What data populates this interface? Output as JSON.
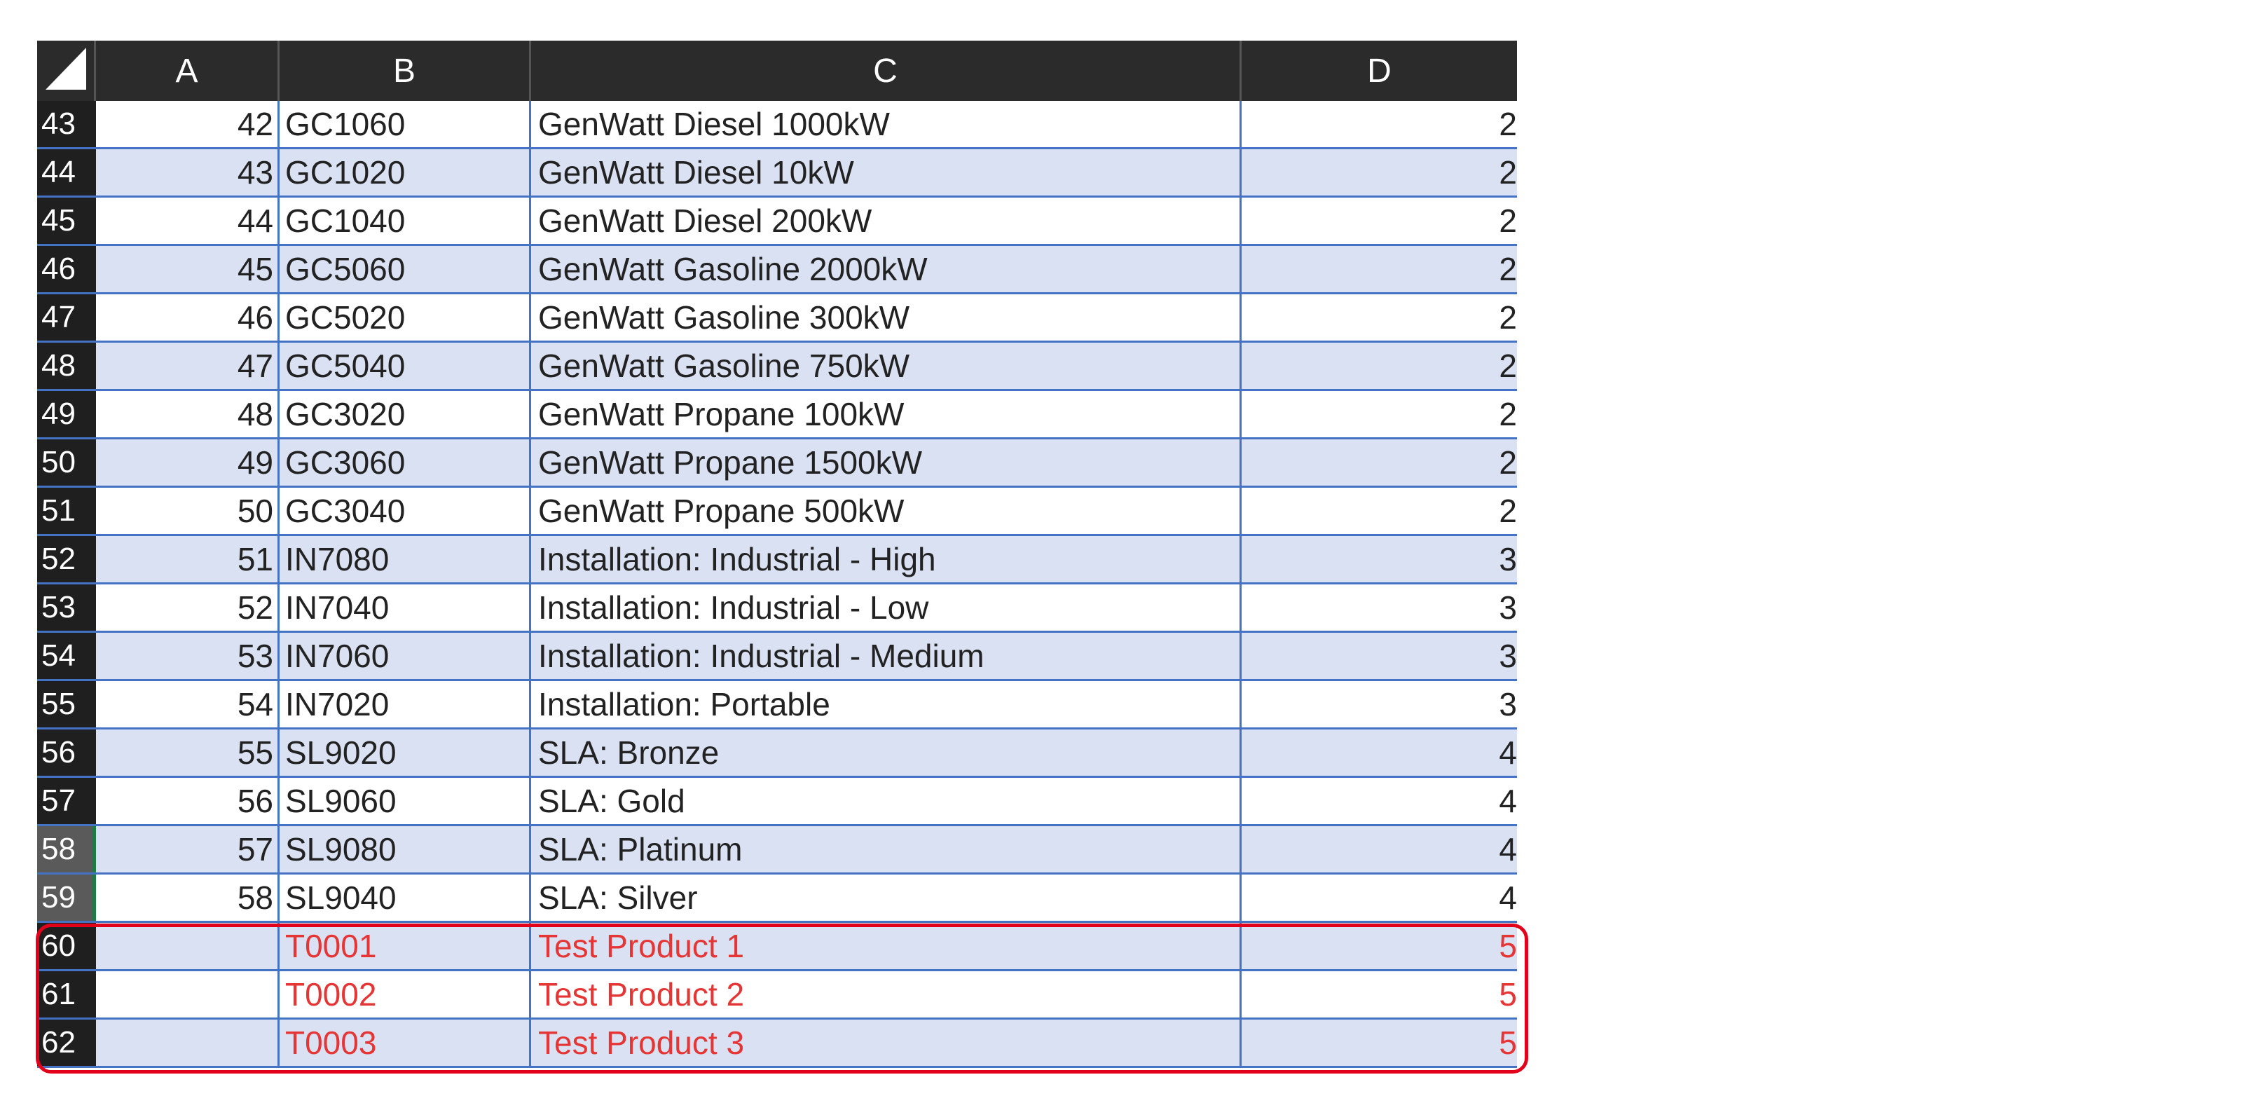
{
  "columns": [
    "A",
    "B",
    "C",
    "D"
  ],
  "rows": [
    {
      "row": "43",
      "a": "42",
      "b": "GC1060",
      "c": "GenWatt Diesel 1000kW",
      "d": "2"
    },
    {
      "row": "44",
      "a": "43",
      "b": "GC1020",
      "c": "GenWatt Diesel 10kW",
      "d": "2"
    },
    {
      "row": "45",
      "a": "44",
      "b": "GC1040",
      "c": "GenWatt Diesel 200kW",
      "d": "2"
    },
    {
      "row": "46",
      "a": "45",
      "b": "GC5060",
      "c": "GenWatt Gasoline 2000kW",
      "d": "2"
    },
    {
      "row": "47",
      "a": "46",
      "b": "GC5020",
      "c": "GenWatt Gasoline 300kW",
      "d": "2"
    },
    {
      "row": "48",
      "a": "47",
      "b": "GC5040",
      "c": "GenWatt Gasoline 750kW",
      "d": "2"
    },
    {
      "row": "49",
      "a": "48",
      "b": "GC3020",
      "c": "GenWatt Propane 100kW",
      "d": "2"
    },
    {
      "row": "50",
      "a": "49",
      "b": "GC3060",
      "c": "GenWatt Propane 1500kW",
      "d": "2"
    },
    {
      "row": "51",
      "a": "50",
      "b": "GC3040",
      "c": "GenWatt Propane 500kW",
      "d": "2"
    },
    {
      "row": "52",
      "a": "51",
      "b": "IN7080",
      "c": "Installation: Industrial - High",
      "d": "3"
    },
    {
      "row": "53",
      "a": "52",
      "b": "IN7040",
      "c": "Installation: Industrial - Low",
      "d": "3"
    },
    {
      "row": "54",
      "a": "53",
      "b": "IN7060",
      "c": "Installation: Industrial - Medium",
      "d": "3"
    },
    {
      "row": "55",
      "a": "54",
      "b": "IN7020",
      "c": "Installation: Portable",
      "d": "3"
    },
    {
      "row": "56",
      "a": "55",
      "b": "SL9020",
      "c": "SLA: Bronze",
      "d": "4"
    },
    {
      "row": "57",
      "a": "56",
      "b": "SL9060",
      "c": "SLA: Gold",
      "d": "4"
    },
    {
      "row": "58",
      "a": "57",
      "b": "SL9080",
      "c": "SLA: Platinum",
      "d": "4"
    },
    {
      "row": "59",
      "a": "58",
      "b": "SL9040",
      "c": "SLA: Silver",
      "d": "4"
    },
    {
      "row": "60",
      "a": "",
      "b": "T0001",
      "c": "Test Product 1",
      "d": "5"
    },
    {
      "row": "61",
      "a": "",
      "b": "T0002",
      "c": "Test Product 2",
      "d": "5"
    },
    {
      "row": "62",
      "a": "",
      "b": "T0003",
      "c": "Test Product 3",
      "d": "5"
    }
  ],
  "colors": {
    "header_bg": "#2b2b2b",
    "band": "#d9e1f2",
    "grid": "#4472c4",
    "highlight_text": "#e53535",
    "highlight_border": "#e3001b"
  }
}
